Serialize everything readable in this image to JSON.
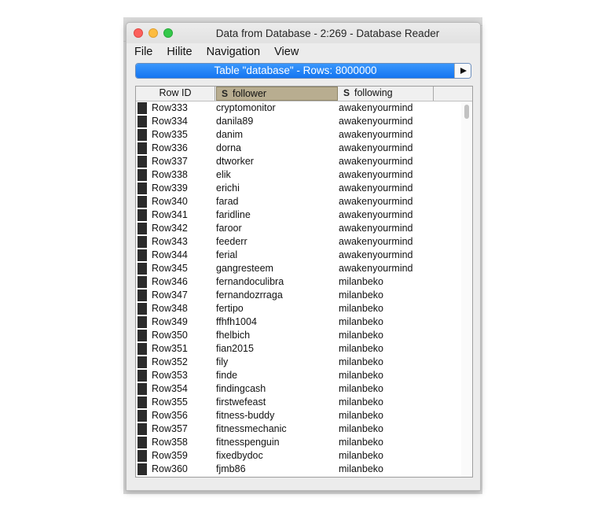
{
  "window": {
    "title": "Data from Database - 2:269 - Database Reader"
  },
  "menu": {
    "items": [
      "File",
      "Hilite",
      "Navigation",
      "View"
    ]
  },
  "tablebar": {
    "label": "Table \"database\" - Rows: 8000000"
  },
  "table": {
    "headers": {
      "row_id": "Row ID",
      "follower": "follower",
      "following": "following",
      "type_badge": "S"
    },
    "rows": [
      {
        "id": "Row333",
        "follower": "cryptomonitor",
        "following": "awakenyourmind"
      },
      {
        "id": "Row334",
        "follower": "danila89",
        "following": "awakenyourmind"
      },
      {
        "id": "Row335",
        "follower": "danim",
        "following": "awakenyourmind"
      },
      {
        "id": "Row336",
        "follower": "dorna",
        "following": "awakenyourmind"
      },
      {
        "id": "Row337",
        "follower": "dtworker",
        "following": "awakenyourmind"
      },
      {
        "id": "Row338",
        "follower": "elik",
        "following": "awakenyourmind"
      },
      {
        "id": "Row339",
        "follower": "erichi",
        "following": "awakenyourmind"
      },
      {
        "id": "Row340",
        "follower": "farad",
        "following": "awakenyourmind"
      },
      {
        "id": "Row341",
        "follower": "faridline",
        "following": "awakenyourmind"
      },
      {
        "id": "Row342",
        "follower": "faroor",
        "following": "awakenyourmind"
      },
      {
        "id": "Row343",
        "follower": "feederr",
        "following": "awakenyourmind"
      },
      {
        "id": "Row344",
        "follower": "ferial",
        "following": "awakenyourmind"
      },
      {
        "id": "Row345",
        "follower": "gangresteem",
        "following": "awakenyourmind"
      },
      {
        "id": "Row346",
        "follower": "fernandoculibra",
        "following": "milanbeko"
      },
      {
        "id": "Row347",
        "follower": "fernandozrraga",
        "following": "milanbeko"
      },
      {
        "id": "Row348",
        "follower": "fertipo",
        "following": "milanbeko"
      },
      {
        "id": "Row349",
        "follower": "ffhfh1004",
        "following": "milanbeko"
      },
      {
        "id": "Row350",
        "follower": "fhelbich",
        "following": "milanbeko"
      },
      {
        "id": "Row351",
        "follower": "fian2015",
        "following": "milanbeko"
      },
      {
        "id": "Row352",
        "follower": "fily",
        "following": "milanbeko"
      },
      {
        "id": "Row353",
        "follower": "finde",
        "following": "milanbeko"
      },
      {
        "id": "Row354",
        "follower": "findingcash",
        "following": "milanbeko"
      },
      {
        "id": "Row355",
        "follower": "firstwefeast",
        "following": "milanbeko"
      },
      {
        "id": "Row356",
        "follower": "fitness-buddy",
        "following": "milanbeko"
      },
      {
        "id": "Row357",
        "follower": "fitnessmechanic",
        "following": "milanbeko"
      },
      {
        "id": "Row358",
        "follower": "fitnesspenguin",
        "following": "milanbeko"
      },
      {
        "id": "Row359",
        "follower": "fixedbydoc",
        "following": "milanbeko"
      },
      {
        "id": "Row360",
        "follower": "fjmb86",
        "following": "milanbeko"
      }
    ]
  },
  "colors": {
    "tablebar_accent": "#1475f1",
    "selected_header": "#b8ad90",
    "close": "#fc605c",
    "minimize": "#fdbc40",
    "maximize": "#34c84a"
  }
}
